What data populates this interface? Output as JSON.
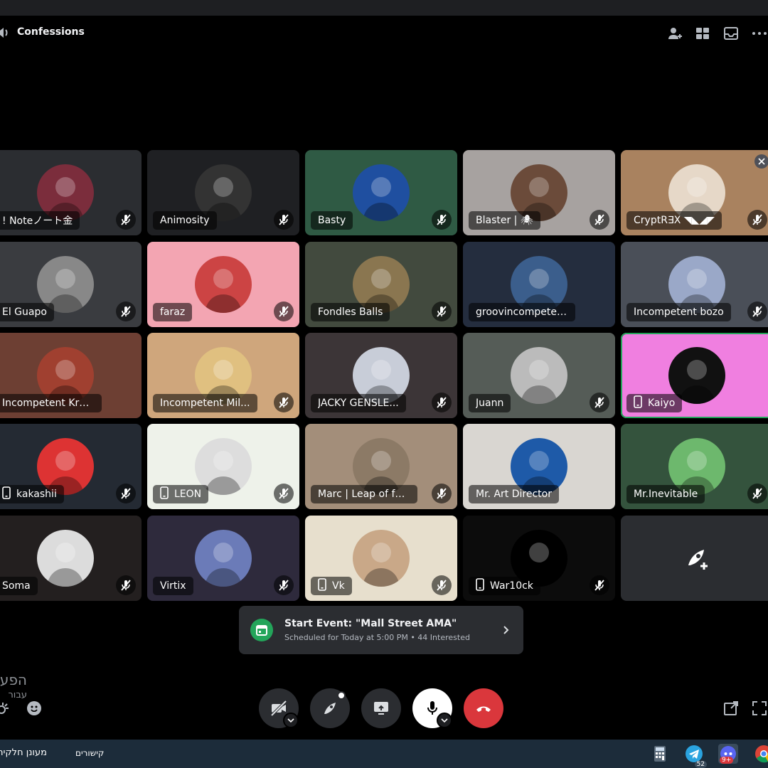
{
  "window": {
    "channel_title": "Confessions",
    "header_icons": [
      "add-friend-icon",
      "grid-layout-icon",
      "inbox-icon",
      "more-icon"
    ]
  },
  "participants": [
    {
      "name": "! Noteノート金",
      "bg": "#2b2d31",
      "muted": true,
      "mobile": false
    },
    {
      "name": "Animosity",
      "bg": "#1f2023",
      "muted": true,
      "mobile": false
    },
    {
      "name": "Basty",
      "bg": "#2f5a44",
      "muted": true,
      "mobile": false
    },
    {
      "name": "Blaster | 🕷",
      "bg": "#a7a2a0",
      "muted": true,
      "mobile": false
    },
    {
      "name": "CryptR∃X ◥◣◢◤",
      "bg": "#a9825f",
      "muted": true,
      "mobile": false
    },
    {
      "name": "El Guapo",
      "bg": "#3a3c40",
      "muted": true,
      "mobile": false
    },
    {
      "name": "faraz",
      "bg": "#f3a5b2",
      "muted": true,
      "mobile": false
    },
    {
      "name": "Fondles Balls",
      "bg": "#424a3e",
      "muted": true,
      "mobile": false
    },
    {
      "name": "groovincompetent pict",
      "bg": "#242d3e",
      "muted": false,
      "mobile": false
    },
    {
      "name": "Incompetent bozo",
      "bg": "#4a4f58",
      "muted": true,
      "mobile": false
    },
    {
      "name": "Incompetent Kractus",
      "bg": "#6d3f33",
      "muted": false,
      "mobile": false
    },
    {
      "name": "Incompetent Mil...",
      "bg": "#cfa67c",
      "muted": true,
      "mobile": false
    },
    {
      "name": "JACKY GENSLE...",
      "bg": "#3c3537",
      "muted": true,
      "mobile": false
    },
    {
      "name": "Juann",
      "bg": "#555c57",
      "muted": true,
      "mobile": false
    },
    {
      "name": "Kaiyo",
      "bg": "#f07fe0",
      "muted": false,
      "mobile": true
    },
    {
      "name": "kakashii",
      "bg": "#242a33",
      "muted": true,
      "mobile": true
    },
    {
      "name": "LEON",
      "bg": "#eef2ea",
      "muted": true,
      "mobile": true
    },
    {
      "name": "Marc | Leap of fa...",
      "bg": "#a38e7a",
      "muted": true,
      "mobile": false
    },
    {
      "name": "Mr. Art Director",
      "bg": "#d9d6d1",
      "muted": false,
      "mobile": false
    },
    {
      "name": "Mr.Inevitable",
      "bg": "#34533d",
      "muted": true,
      "mobile": false
    },
    {
      "name": "Soma",
      "bg": "#231f1f",
      "muted": true,
      "mobile": false
    },
    {
      "name": "Virtix",
      "bg": "#2e2a3c",
      "muted": true,
      "mobile": false
    },
    {
      "name": "Vk",
      "bg": "#e7dfcd",
      "muted": true,
      "mobile": true
    },
    {
      "name": "War10ck",
      "bg": "#0c0c0c",
      "muted": true,
      "mobile": true
    }
  ],
  "event": {
    "title": "Start Event: \"Mall Street AMA\"",
    "subtitle": "Scheduled for Today at 5:00 PM  •  44 Interested"
  },
  "composer": {
    "rtl_line1": "הפע",
    "rtl_line2": "עבור"
  },
  "controls": [
    "camera-off-icon",
    "activity-rocket-icon",
    "screen-share-icon",
    "microphone-icon",
    "hang-up-icon"
  ],
  "taskbar": {
    "left_label": "מעונן חלקית",
    "links_label": "קישורים",
    "telegram_badge": "52",
    "discord_badge": "9+"
  }
}
